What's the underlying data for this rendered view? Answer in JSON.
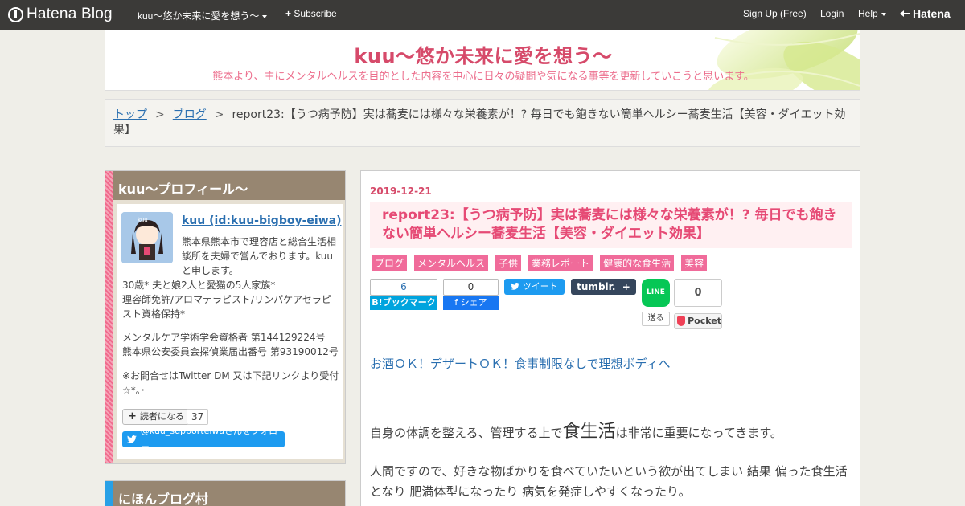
{
  "topbar": {
    "logo_text": "Hatena Blog",
    "blog_name": "kuu～悠か未来に愛を想う～",
    "subscribe": "Subscribe",
    "signup": "Sign Up (Free)",
    "login": "Login",
    "help": "Help",
    "hatena": "Hatena"
  },
  "header": {
    "title": "kuu～悠か未来に愛を想う～",
    "description": "熊本より、主にメンタルヘルスを目的とした内容を中心に日々の疑問や気になる事等を更新していこうと思います。"
  },
  "breadcrumb": {
    "items": [
      "トップ",
      "ブログ"
    ],
    "separator": ">",
    "current": "report23:【うつ病予防】実は蕎麦には様々な栄養素が！? 毎日でも飽きない簡単ヘルシー蕎麦生活【美容・ダイエット効果】"
  },
  "sidebar": {
    "profile": {
      "heading": "kuu～プロフィール～",
      "name": "kuu (id:kuu-bigboy-eiwa)",
      "text1": "熊本県熊本市で理容店と総合生活相談所を夫婦で営んでおります。kuuと申します。",
      "text2": "30歳* 夫と娘2人と愛猫の5人家族*\n理容師免許/アロマテラピスト/リンパケアセラピスト資格保持*",
      "text3": "メンタルケア学術学会資格者 第144129224号\n熊本県公安委員会探偵業届出番号 第93190012号",
      "text4": "※お問合せはTwitter DM 又は下記リンクより受付☆*｡･",
      "reader_button": "読者になる",
      "reader_count": "37",
      "twitter_follow": "@kuu_supporteiwaさんをフォロー"
    },
    "village": {
      "heading": "にほんブログ村"
    }
  },
  "article": {
    "date": "2019-12-21",
    "title": "report23:【うつ病予防】実は蕎麦には様々な栄養素が！? 毎日でも飽きない簡単ヘルシー蕎麦生活【美容・ダイエット効果】",
    "categories": [
      "ブログ",
      "メンタルヘルス",
      "子供",
      "業務レポート",
      "健康的な食生活",
      "美容"
    ],
    "share": {
      "hatebu_count": "6",
      "hatebu_label": "B!ブックマーク",
      "fb_count": "0",
      "fb_label": "f シェア",
      "tweet_label": "ツイート",
      "tumblr_label": "tumblr.",
      "line_label": "LINE",
      "line_send": "送る",
      "pocket_count": "0",
      "pocket_label": "Pocket"
    },
    "ad_link": "お酒ＯＫ！デザートＯＫ！食事制限なしで理想ボディへ",
    "para1_pre": "自身の体調を整える、管理する上で",
    "para1_big": "食生活",
    "para1_post": "は非常に重要になってきます。",
    "para2": "人間ですので、好きな物ばかりを食べていたいという欲が出てしまい 結果 偏った食生活となり 肥満体型になったり 病気を発症しやすくなったり。"
  },
  "colors": {
    "accent_pink": "#d64a6a",
    "topbar_bg": "#3b3a38",
    "sidebar_head": "#978671"
  }
}
